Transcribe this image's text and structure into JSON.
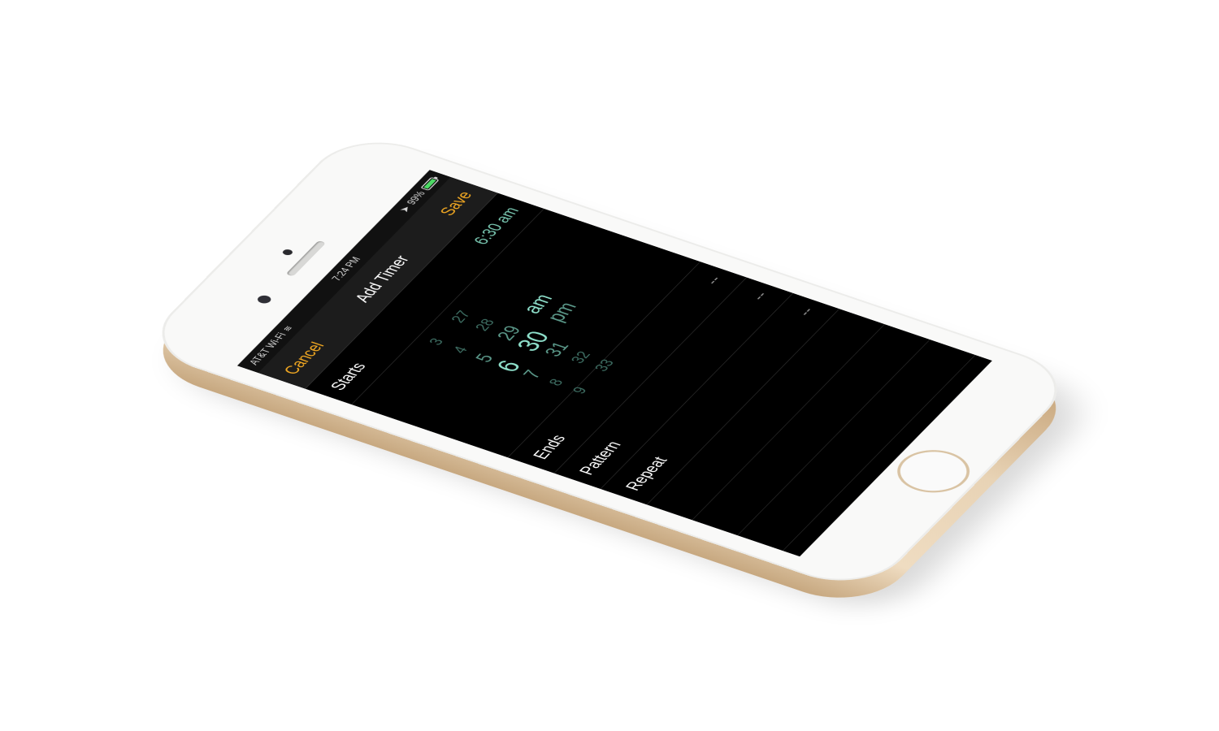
{
  "statusbar": {
    "carrier": "AT&T Wi-Fi",
    "time": "7:24 PM",
    "battery": "99%"
  },
  "navbar": {
    "cancel_label": "Cancel",
    "title": "Add Timer",
    "save_label": "Save"
  },
  "starts": {
    "label": "Starts",
    "value": "6:30 am"
  },
  "picker": {
    "hours": [
      "3",
      "4",
      "5",
      "6",
      "7",
      "8",
      "9"
    ],
    "minutes": [
      "27",
      "28",
      "29",
      "30",
      "31",
      "32",
      "33"
    ],
    "ampm": [
      "am",
      "pm"
    ]
  },
  "ends": {
    "label": "Ends",
    "value": "--"
  },
  "pattern": {
    "label": "Pattern",
    "value": "--"
  },
  "repeat": {
    "label": "Repeat",
    "value": "--"
  },
  "colors": {
    "accent": "#f3a922",
    "picker_selected": "#8fe1cc",
    "battery": "#4cd964"
  }
}
